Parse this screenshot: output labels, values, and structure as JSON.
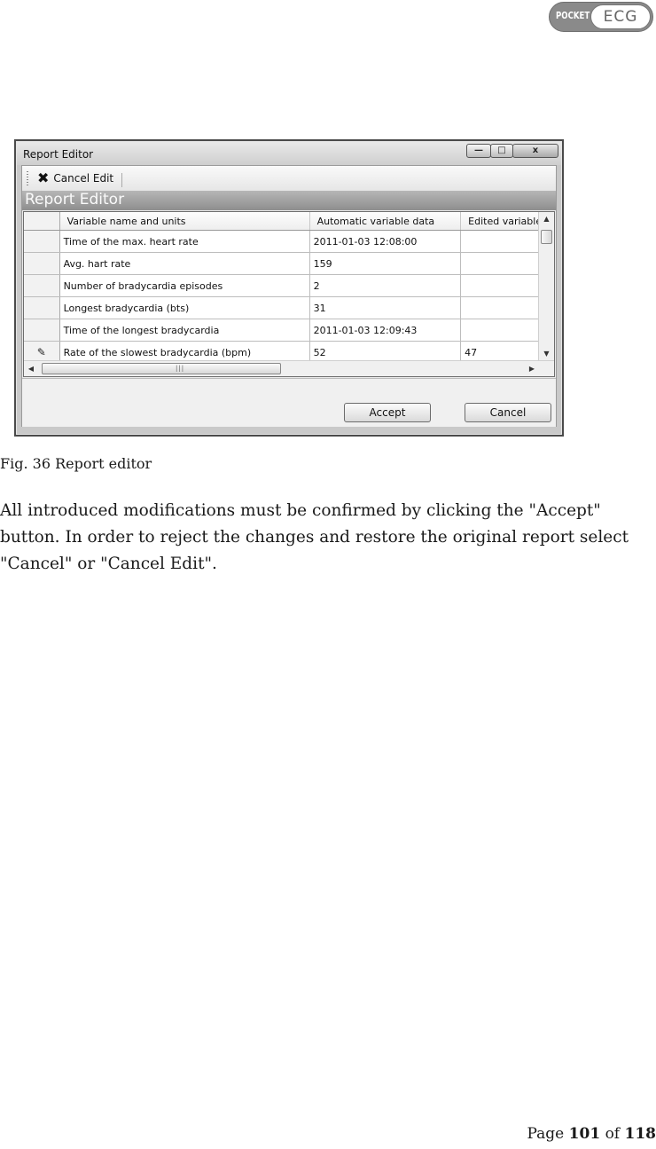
{
  "logo": {
    "left_text": "POCKET",
    "right_text": "ECG"
  },
  "window": {
    "title": "Report Editor",
    "controls": {
      "minimize": "—",
      "maximize": "□",
      "close": "x"
    },
    "toolbar": {
      "cancel_edit_label": "Cancel Edit"
    },
    "header_band": "Report Editor",
    "grid": {
      "columns": [
        "Variable name and units",
        "Automatic variable data",
        "Edited variable"
      ],
      "rows": [
        {
          "indicator": "",
          "name": "Time of the max. heart rate",
          "auto": "2011-01-03 12:08:00",
          "edited": ""
        },
        {
          "indicator": "",
          "name": "Avg. hart rate",
          "auto": "159",
          "edited": ""
        },
        {
          "indicator": "",
          "name": "Number of bradycardia episodes",
          "auto": "2",
          "edited": ""
        },
        {
          "indicator": "",
          "name": "Longest bradycardia (bts)",
          "auto": "31",
          "edited": ""
        },
        {
          "indicator": "",
          "name": "Time of the longest bradycardia",
          "auto": "2011-01-03 12:09:43",
          "edited": ""
        },
        {
          "indicator": "✎",
          "name": "Rate of the slowest bradycardia (bpm)",
          "auto": "52",
          "edited": "47"
        }
      ]
    },
    "buttons": {
      "accept": "Accept",
      "cancel": "Cancel"
    }
  },
  "caption": "Fig. 36 Report editor",
  "paragraph": "All introduced modifications must be confirmed by clicking the \"Accept\" button. In order to reject the changes and restore the original report select \"Cancel\" or \"Cancel Edit\".",
  "footer": {
    "prefix": "Page",
    "page": "101",
    "of": "of",
    "total": "118"
  }
}
